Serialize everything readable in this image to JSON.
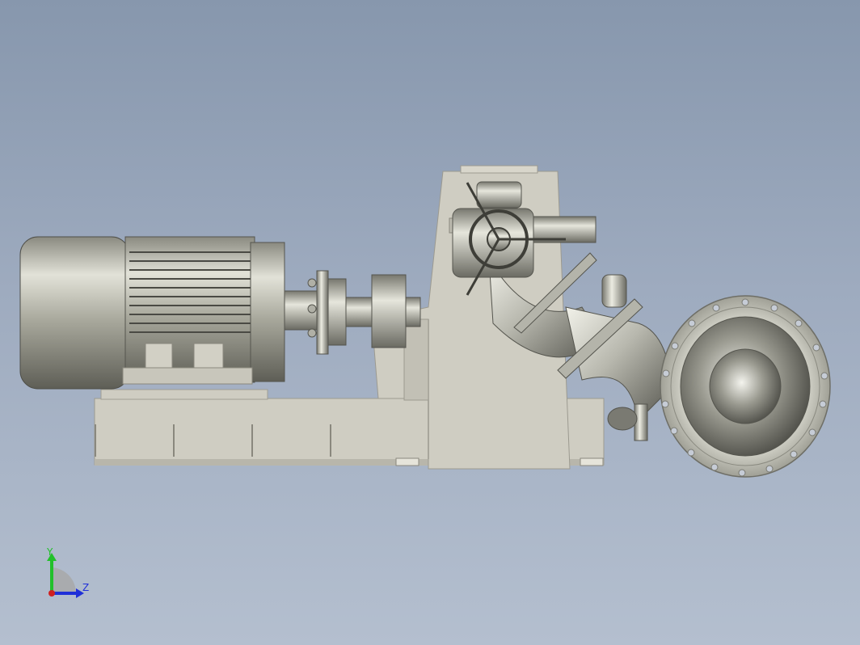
{
  "viewport": {
    "background_top": "#8797ad",
    "background_bottom": "#b4bfcf",
    "part_color": "#c9c8bd",
    "part_shadow": "#8e8d84"
  },
  "triad": {
    "y_label": "Y",
    "z_label": "Z",
    "y_color": "#22c02a",
    "z_color": "#2030d8",
    "x_color": "#d02020"
  },
  "model": {
    "components": [
      "motor",
      "coupling",
      "pump-casing",
      "valve-handwheel",
      "elbow-pipe",
      "outlet-flange",
      "baseplate"
    ]
  }
}
